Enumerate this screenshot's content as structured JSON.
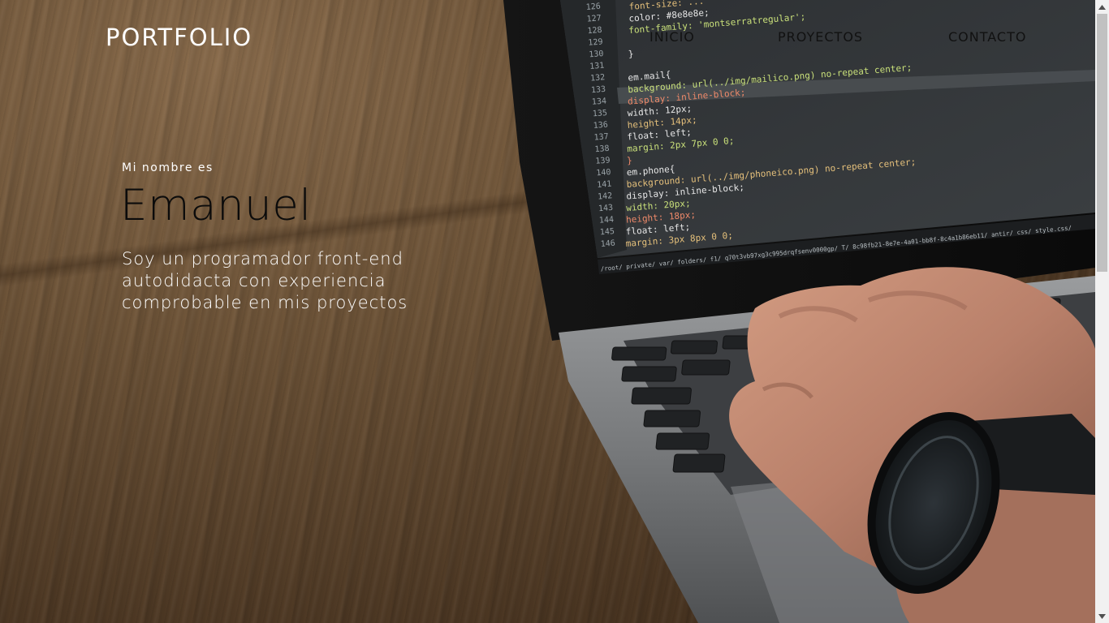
{
  "nav": {
    "brand": "PORTFOLIO",
    "links": [
      "INICIO",
      "PROYECTOS",
      "CONTACTO"
    ]
  },
  "hero": {
    "intro": "Mi nombre es",
    "name": "Emanuel",
    "tagline": "Soy un programador front-end autodidacta con experiencia comprobable en mis proyectos",
    "background_image": "laptop-coding-photo"
  },
  "code_lines": [
    {
      "num": "126",
      "text": "    font-size: ..."
    },
    {
      "num": "127",
      "text": "    color: #8e8e8e;"
    },
    {
      "num": "128",
      "text": "    font-family: 'montserratregular';"
    },
    {
      "num": "129",
      "text": ""
    },
    {
      "num": "130",
      "text": "}"
    },
    {
      "num": "131",
      "text": ""
    },
    {
      "num": "132",
      "text": "em.mail{"
    },
    {
      "num": "133",
      "text": "    background: url(../img/mailico.png) no-repeat center;"
    },
    {
      "num": "134",
      "text": "    display: inline-block;"
    },
    {
      "num": "135",
      "text": "    width: 12px;"
    },
    {
      "num": "136",
      "text": "    height: 14px;"
    },
    {
      "num": "137",
      "text": "    float: left;"
    },
    {
      "num": "138",
      "text": "    margin: 2px 7px 0 0;"
    },
    {
      "num": "139",
      "text": "}"
    },
    {
      "num": "140",
      "text": "em.phone{"
    },
    {
      "num": "141",
      "text": "    background: url(../img/phoneico.png) no-repeat center;"
    },
    {
      "num": "142",
      "text": "    display: inline-block;"
    },
    {
      "num": "143",
      "text": "        width: 20px;"
    },
    {
      "num": "144",
      "text": "    height: 18px;"
    },
    {
      "num": "145",
      "text": "    float: left;"
    },
    {
      "num": "146",
      "text": "    margin: 3px 8px 0 0;"
    }
  ],
  "status_path": "/root/ private/ var/ folders/ f1/ q70t3vb97xg3c995drqfsenv0000gp/ T/ 8c98fb21-8e7e-4a01-bb8f-8c4a1b86eb11/ antir/ css/ style.css/",
  "scrollbar": {
    "thumb_fraction": 0.42
  },
  "colors": {
    "nav_text": "#111111",
    "brand_text": "#ffffff",
    "name_text": "#0b0b0b",
    "tagline_text": "#ffffff"
  }
}
